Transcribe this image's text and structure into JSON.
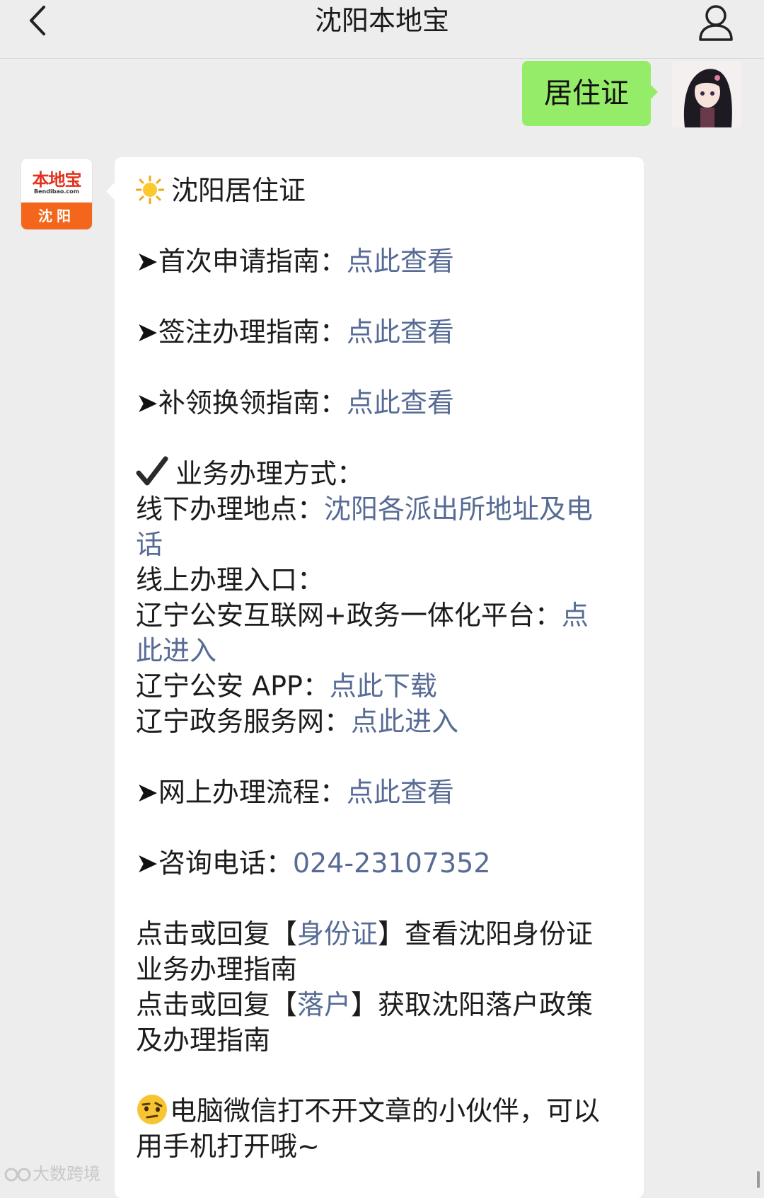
{
  "header": {
    "title": "沈阳本地宝"
  },
  "chat": {
    "outgoing_message": "居住证",
    "bot_avatar": {
      "brand": "本地宝",
      "site": "Bendibao.com",
      "city": "沈阳"
    },
    "reply": {
      "title": "沈阳居住证",
      "guide_items": [
        {
          "bullet": "➤",
          "label": "首次申请指南：",
          "link": "点此查看"
        },
        {
          "bullet": "➤",
          "label": "签注办理指南：",
          "link": "点此查看"
        },
        {
          "bullet": "➤",
          "label": "补领换领指南：",
          "link": "点此查看"
        }
      ],
      "method_heading": "业务办理方式：",
      "offline_label": "线下办理地点：",
      "offline_link_line1": "沈阳各派出所地址及电",
      "offline_link_line2": "话",
      "online_label": "线上办理入口：",
      "platform_label": "辽宁公安互联网+政务一体化平台：",
      "platform_link_line1": "点",
      "platform_link_line2": "此进入",
      "app_label": "辽宁公安 APP：",
      "app_link": "点此下载",
      "gov_label": "辽宁政务服务网：",
      "gov_link": "点此进入",
      "process_bullet": "➤",
      "process_label": "网上办理流程：",
      "process_link": "点此查看",
      "phone_bullet": "➤",
      "phone_label": "咨询电话：",
      "phone_number": "024-23107352",
      "id_prefix": "点击或回复【",
      "id_link": "身份证",
      "id_suffix": "】查看沈阳身份证",
      "id_line2": "业务办理指南",
      "hukou_prefix": "点击或回复【",
      "hukou_link": "落户",
      "hukou_suffix": "】获取沈阳落户政策",
      "hukou_line2": "及办理指南",
      "pc_note_line1": "电脑微信打不开文章的小伙伴，可以",
      "pc_note_line2": "用手机打开哦~"
    }
  },
  "watermark": "大数跨境"
}
